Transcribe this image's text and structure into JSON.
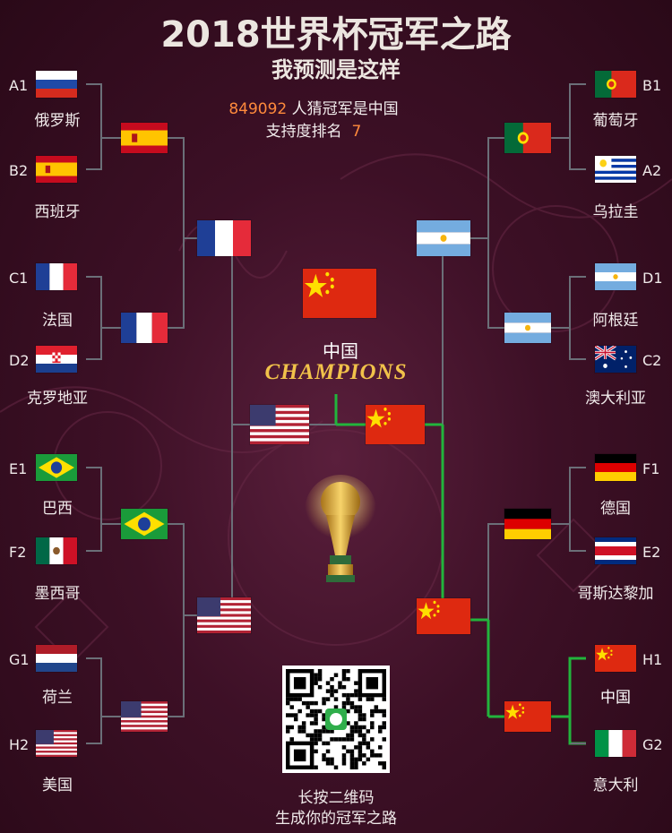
{
  "header": {
    "title": "2018世界杯冠军之路",
    "subtitle": "我预测是这样"
  },
  "stats": {
    "guess_count": "849092",
    "guess_text": "人猜冠军是中国",
    "rank_label": "支持度排名",
    "rank_value": "7"
  },
  "groups_left": [
    {
      "slot": "A1",
      "team": "俄罗斯",
      "flag": "russia"
    },
    {
      "slot": "B2",
      "team": "西班牙",
      "flag": "spain"
    },
    {
      "slot": "C1",
      "team": "法国",
      "flag": "france"
    },
    {
      "slot": "D2",
      "team": "克罗地亚",
      "flag": "croatia"
    },
    {
      "slot": "E1",
      "team": "巴西",
      "flag": "brazil"
    },
    {
      "slot": "F2",
      "team": "墨西哥",
      "flag": "mexico"
    },
    {
      "slot": "G1",
      "team": "荷兰",
      "flag": "netherlands"
    },
    {
      "slot": "H2",
      "team": "美国",
      "flag": "usa"
    }
  ],
  "groups_right": [
    {
      "slot": "B1",
      "team": "葡萄牙",
      "flag": "portugal"
    },
    {
      "slot": "A2",
      "team": "乌拉圭",
      "flag": "uruguay"
    },
    {
      "slot": "D1",
      "team": "阿根廷",
      "flag": "argentina"
    },
    {
      "slot": "C2",
      "team": "澳大利亚",
      "flag": "australia"
    },
    {
      "slot": "F1",
      "team": "德国",
      "flag": "germany"
    },
    {
      "slot": "E2",
      "team": "哥斯达黎加",
      "flag": "costarica"
    },
    {
      "slot": "H1",
      "team": "中国",
      "flag": "china"
    },
    {
      "slot": "G2",
      "team": "意大利",
      "flag": "italy"
    }
  ],
  "quarter_left": [
    "spain",
    "france",
    "brazil",
    "usa"
  ],
  "semi_left": [
    "france",
    "usa"
  ],
  "final_left": "usa",
  "quarter_right": [
    "portugal",
    "argentina",
    "germany",
    "china"
  ],
  "semi_right": [
    "argentina",
    "china"
  ],
  "final_right": "china",
  "champion": {
    "flag": "china",
    "name": "中国",
    "word": "CHAMPIONS"
  },
  "qr": {
    "line1": "长按二维码",
    "line2": "生成你的冠军之路"
  },
  "colors": {
    "winner_path": "#22b43c",
    "bracket_line": "#6b6f78",
    "highlight": "#ff8a3c",
    "champions_gold": "#f1c24a"
  }
}
